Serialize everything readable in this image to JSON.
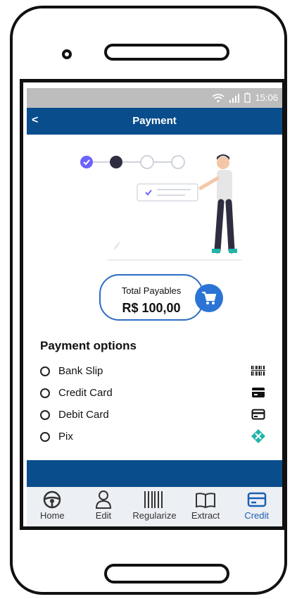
{
  "status": {
    "time": "15:06"
  },
  "header": {
    "back_label": "<",
    "title": "Payment"
  },
  "summary": {
    "label": "Total Payables",
    "amount": "R$ 100,00"
  },
  "options": {
    "title": "Payment options",
    "items": [
      {
        "label": "Bank Slip",
        "icon": "barcode-icon"
      },
      {
        "label": "Credit Card",
        "icon": "credit-card-icon"
      },
      {
        "label": "Debit Card",
        "icon": "debit-card-icon"
      },
      {
        "label": "Pix",
        "icon": "pix-icon"
      }
    ]
  },
  "nav": {
    "items": [
      {
        "label": "Home",
        "icon": "steering-wheel-icon"
      },
      {
        "label": "Edit",
        "icon": "user-icon"
      },
      {
        "label": "Regularize",
        "icon": "barcode-icon"
      },
      {
        "label": "Extract",
        "icon": "book-icon"
      },
      {
        "label": "Credit",
        "icon": "credit-card-icon",
        "active": true
      }
    ]
  },
  "colors": {
    "primary": "#0a4d8c",
    "accent": "#2b74d6",
    "pix": "#1fb5a8"
  }
}
